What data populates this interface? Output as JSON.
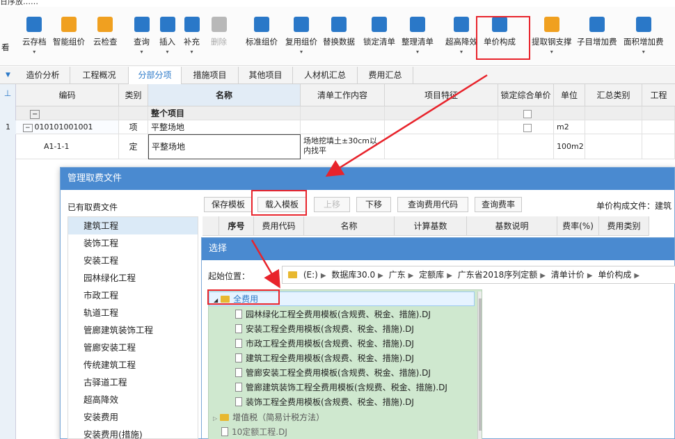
{
  "app": {
    "top_text": "日序放……"
  },
  "ribbon": {
    "buttons": [
      {
        "key": "look",
        "label": "看",
        "icon": "view-icon"
      },
      {
        "key": "cloud_save",
        "label": "云存档",
        "icon": "cloud-upload-icon"
      },
      {
        "key": "smart_price",
        "label": "智能组价",
        "icon": "smart-price-icon"
      },
      {
        "key": "cloud_check",
        "label": "云检查",
        "icon": "cloud-check-icon"
      },
      {
        "key": "query",
        "label": "查询",
        "icon": "query-icon"
      },
      {
        "key": "insert",
        "label": "插入",
        "icon": "insert-icon"
      },
      {
        "key": "supplement",
        "label": "补充",
        "icon": "supplement-icon"
      },
      {
        "key": "delete",
        "label": "删除",
        "icon": "trash-icon"
      },
      {
        "key": "std_price",
        "label": "标准组价",
        "icon": "std-price-icon"
      },
      {
        "key": "reuse_price",
        "label": "复用组价",
        "icon": "reuse-price-icon"
      },
      {
        "key": "replace_data",
        "label": "替换数据",
        "icon": "replace-icon"
      },
      {
        "key": "lock_list",
        "label": "锁定清单",
        "icon": "lock-icon"
      },
      {
        "key": "organize_list",
        "label": "整理清单",
        "icon": "organize-icon"
      },
      {
        "key": "super_height",
        "label": "超高降效",
        "icon": "super-height-icon"
      },
      {
        "key": "unit_price",
        "label": "单价构成",
        "icon": "unit-price-icon"
      },
      {
        "key": "steel_support",
        "label": "提取钢支撑",
        "icon": "steel-support-icon"
      },
      {
        "key": "sub_fee",
        "label": "子目增加费",
        "icon": "sub-fee-icon"
      },
      {
        "key": "area_fee",
        "label": "面积增加费",
        "icon": "area-fee-icon"
      }
    ]
  },
  "tabs": [
    "造价分析",
    "工程概况",
    "分部分项",
    "措施项目",
    "其他项目",
    "人材机汇总",
    "费用汇总"
  ],
  "grid": {
    "columns": [
      "编码",
      "类别",
      "名称",
      "清单工作内容",
      "项目特征",
      "锁定综合单价",
      "单位",
      "汇总类别",
      "工程"
    ],
    "rows": [
      {
        "num": "",
        "code": "",
        "type": "",
        "name": "整个项目",
        "work": "",
        "feature": "",
        "unit": ""
      },
      {
        "num": "1",
        "code": "010101001001",
        "type": "项",
        "name": "平整场地",
        "work": "",
        "feature": "",
        "unit": "m2"
      },
      {
        "num": "",
        "code": "A1-1-1",
        "type": "定",
        "name": "平整场地",
        "work": "场地挖填土±30cm以内找平",
        "feature": "",
        "unit": "100m2"
      }
    ]
  },
  "fee_dialog": {
    "title": "管理取费文件",
    "list_title": "已有取费文件",
    "items": [
      "建筑工程",
      "装饰工程",
      "安装工程",
      "园林绿化工程",
      "市政工程",
      "轨道工程",
      "管廊建筑装饰工程",
      "管廊安装工程",
      "传统建筑工程",
      "古驿道工程",
      "超高降效",
      "安装费用",
      "安装费用(措施)"
    ],
    "toolbar": {
      "save": "保存模板",
      "load": "载入模板",
      "up": "上移",
      "down": "下移",
      "query_code": "查询费用代码",
      "query_rate": "查询费率"
    },
    "unit_file_label": "单价构成文件：",
    "unit_file_value": "建筑",
    "columns": [
      "序号",
      "费用代码",
      "名称",
      "计算基数",
      "基数说明",
      "费率(%)",
      "费用类别"
    ]
  },
  "select_dialog": {
    "title": "选择",
    "start_label": "起始位置：",
    "path": [
      "(E:)",
      "数据库30.0",
      "广东",
      "定额库",
      "广东省2018序列定额",
      "清单计价",
      "单价构成"
    ],
    "tree": {
      "folder1": "全费用",
      "files": [
        "园林绿化工程全费用模板(含规费、税金、措施).DJ",
        "安装工程全费用模板(含规费、税金、措施).DJ",
        "市政工程全费用模板(含规费、税金、措施).DJ",
        "建筑工程全费用模板(含规费、税金、措施).DJ",
        "管廊安装工程全费用模板(含规费、税金、措施).DJ",
        "管廊建筑装饰工程全费用模板(含规费、税金、措施).DJ",
        "装饰工程全费用模板(含规费、税金、措施).DJ"
      ],
      "folder2": "增值税（简易计税方法）",
      "file_bottom": "10定额工程.DJ"
    }
  },
  "colors": {
    "accent": "#2a78c8",
    "title_bar": "#4a8ad0",
    "highlight": "#e8232b",
    "tree_bg": "#cfe8cf"
  }
}
